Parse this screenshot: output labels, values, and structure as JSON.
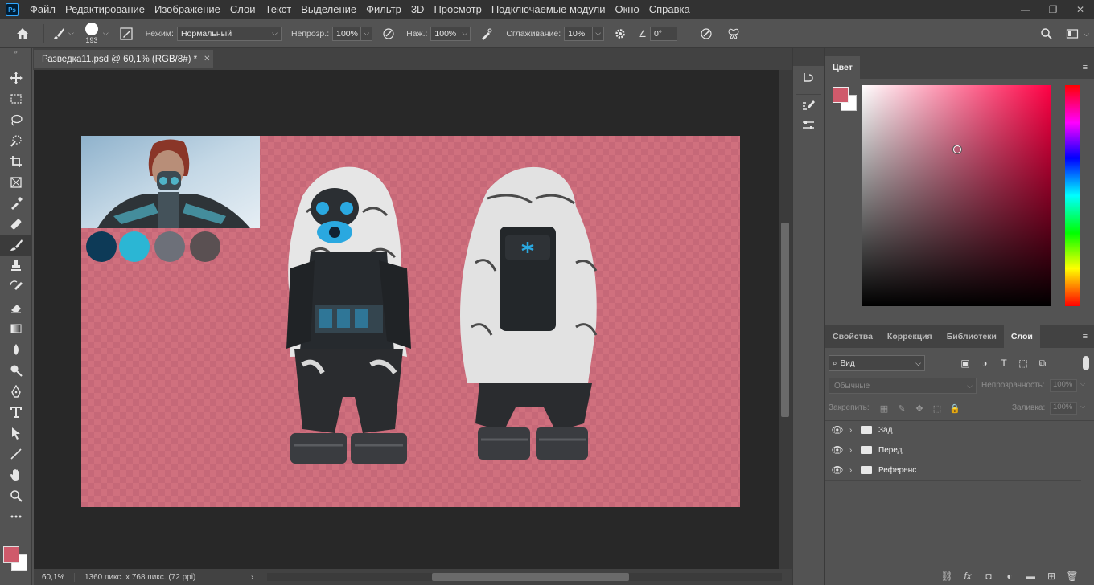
{
  "app": {
    "logo_text": "Ps"
  },
  "menu": [
    "Файл",
    "Редактирование",
    "Изображение",
    "Слои",
    "Текст",
    "Выделение",
    "Фильтр",
    "3D",
    "Просмотр",
    "Подключаемые модули",
    "Окно",
    "Справка"
  ],
  "window_controls": {
    "minimize": "—",
    "restore": "❐",
    "close": "✕"
  },
  "options": {
    "brush_size": "193",
    "mode_label": "Режим:",
    "mode_value": "Нормальный",
    "opacity_label": "Непрозр.:",
    "opacity_value": "100%",
    "pressure_label": "Наж.:",
    "pressure_value": "100%",
    "smoothing_label": "Сглаживание:",
    "smoothing_value": "10%",
    "angle_value": "0°"
  },
  "document": {
    "tab_title": "Разведка11.psd @ 60,1% (RGB/8#) *",
    "zoom": "60,1%",
    "info": "1360 пикс. x 768 пикс. (72 ppi)"
  },
  "swatches": [
    "#0d3a57",
    "#2bb6d4",
    "#6d7079",
    "#5a5052"
  ],
  "colors": {
    "foreground": "#cf5a6b",
    "background": "#ffffff",
    "canvas_bg": "#d0707e"
  },
  "color_panel": {
    "tab": "Цвет"
  },
  "layers_panel": {
    "tabs": [
      "Свойства",
      "Коррекция",
      "Библиотеки",
      "Слои"
    ],
    "filter_label": "Вид",
    "blend_mode": "Обычные",
    "opacity_label": "Непрозрачность:",
    "opacity_value": "100%",
    "lock_label": "Закрепить:",
    "fill_label": "Заливка:",
    "fill_value": "100%",
    "layers": [
      {
        "name": "Зад"
      },
      {
        "name": "Перед"
      },
      {
        "name": "Референс"
      }
    ]
  }
}
